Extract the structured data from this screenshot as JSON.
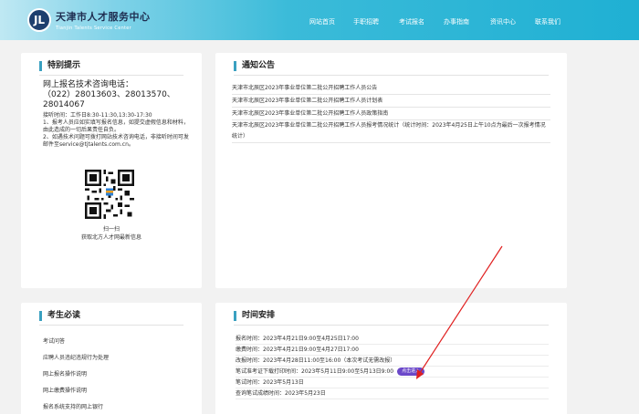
{
  "header": {
    "logo_text": "JL",
    "site_name_cn": "天津市人才服务中心",
    "site_name_en": "Tianjin Talents Service Center",
    "nav": [
      "网站首页",
      "手职招聘",
      "考试报名",
      "办事指南",
      "资讯中心",
      "联系我们"
    ]
  },
  "tips": {
    "title": "特别提示",
    "hotline_label": "网上报名技术咨询电话：",
    "hotline_numbers": "（022）28013603、28013570、28014067",
    "hours": "接听时间：工作日8:30-11:30,13:30-17:30",
    "line1": "1、报考人员应如实填写报名信息，如提交虚假信息和材料，由此造成的一切后果责任自负。",
    "line2": "2、如遇技术问题可拨打网站技术咨询电话，非接听时间可发邮件至service@tjtalents.com.cn。",
    "qr_caption1": "扫一扫",
    "qr_caption2": "获取北方人才网最新信息"
  },
  "notices": {
    "title": "通知公告",
    "items": [
      "天津市北辰区2023年事业单位第二批公开招聘工作人员公告",
      "天津市北辰区2023年事业单位第二批公开招聘工作人员计划表",
      "天津市北辰区2023年事业单位第二批公开招聘工作人员政策指南",
      "天津市北辰区2023年事业单位第二批公开招聘工作人员报考情况统计（统计时间：2023年4月25日上午10点为最后一次报考情况统计）"
    ]
  },
  "must_read": {
    "title": "考生必读",
    "items": [
      "考试问答",
      "应聘人员违纪违规行为处理",
      "网上报名操作说明",
      "网上缴费操作说明",
      "报名系统支持的网上银行"
    ]
  },
  "schedule": {
    "title": "时间安排",
    "items": [
      "报名时间：2023年4月21日9:00至4月25日17:00",
      "缴费时间：2023年4月21日9:00至4月27日17:00",
      "改报时间：2023年4月28日11:00至16:00（本次考试无需改报）",
      "笔试准考证下载打印时间：2023年5月11日9:00至5月13日9:00",
      "笔试时间：2023年5月13日",
      "查询笔试成绩时间：2023年5月23日"
    ],
    "enter_button": "点击进入"
  },
  "colors": {
    "header_gradient_end": "#1fb0d3",
    "title_accent": "#3aa0c0",
    "enter_button": "#6b48c9",
    "annotation_arrow": "#e02020"
  }
}
